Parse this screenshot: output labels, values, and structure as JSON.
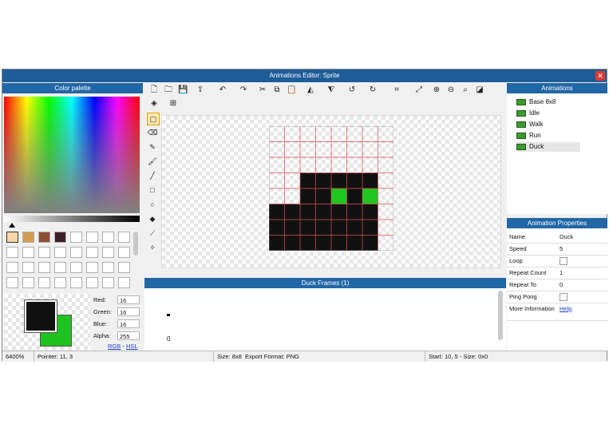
{
  "window": {
    "title": "Animations Editor: Sprite"
  },
  "palette": {
    "title": "Color palette",
    "swatches": [
      "#f7d7a8",
      "#d49a50",
      "#8e4e36",
      "#3d1f2b"
    ],
    "primary_color": "#101010",
    "secondary_color": "#1fc31f",
    "fields": [
      {
        "label": "Red:",
        "value": "16"
      },
      {
        "label": "Green:",
        "value": "16"
      },
      {
        "label": "Blue:",
        "value": "16"
      },
      {
        "label": "Alpha:",
        "value": "255"
      }
    ],
    "link_rgb": "RGB",
    "link_sep": " - ",
    "link_hsl": "HSL"
  },
  "toolbar": {
    "icons": [
      "new-file-icon",
      "open-folder-icon",
      "save-icon",
      "export-icon",
      "undo-icon",
      "redo-icon",
      "cut-icon",
      "copy-icon",
      "paste-icon",
      "flip-horizontal-icon",
      "flip-vertical-icon",
      "rotate-left-icon",
      "rotate-right-icon",
      "crop-icon",
      "resize-icon",
      "zoom-in-icon",
      "zoom-out-icon",
      "zoom-fit-icon",
      "zoom-actual-icon",
      "layers-icon",
      "grid-icon"
    ]
  },
  "tools": [
    "select-tool-icon",
    "eraser-tool-icon",
    "pencil-tool-icon",
    "brush-tool-icon",
    "line-tool-icon",
    "rectangle-tool-icon",
    "ellipse-tool-icon",
    "fill-tool-icon",
    "eyedropper-tool-icon",
    "magic-wand-tool-icon"
  ],
  "sprite": {
    "grid": [
      "........",
      "........",
      "........",
      "..BBBBB.",
      "..BBGBG.",
      "BBBBBBB.",
      "BBBBBBB.",
      "BBBBBBB."
    ],
    "black": "#111111",
    "green": "#1ec71e"
  },
  "frames": {
    "title": "Duck Frames (1)",
    "frame_index": "0"
  },
  "animations": {
    "title": "Animations",
    "items": [
      "Base 8x8",
      "Idle",
      "Walk",
      "Run",
      "Duck"
    ],
    "selected": "Duck"
  },
  "properties": {
    "title": "Animation Properties",
    "rows": [
      {
        "key": "Name",
        "value": "Duck"
      },
      {
        "key": "Speed",
        "value": "5"
      },
      {
        "key": "Loop",
        "value": ""
      },
      {
        "key": "Repeat Count",
        "value": "1"
      },
      {
        "key": "Repeat To",
        "value": "0"
      },
      {
        "key": "Ping Pong",
        "value": ""
      }
    ],
    "more_key": "More Information",
    "help_link": "Help"
  },
  "status": {
    "zoom": "6400%",
    "pointer": "Pointer: 11, 3",
    "size": "Size: 8x8",
    "export_format": "Export Format: PNG",
    "selection": "Start: 10, 5 - Size: 0x0"
  }
}
